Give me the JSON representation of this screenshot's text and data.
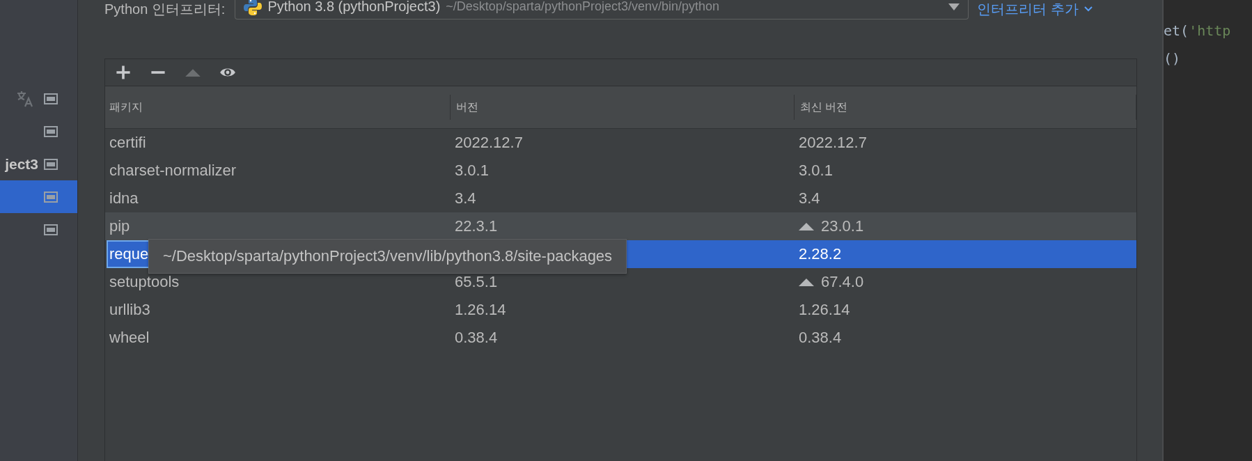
{
  "sidebar": {
    "items": [
      {
        "kind": "translate",
        "selected": false
      },
      {
        "kind": "plain",
        "selected": false
      },
      {
        "kind": "plain",
        "label": "ject3",
        "selected": false
      },
      {
        "kind": "plain",
        "selected": true
      },
      {
        "kind": "plain",
        "selected": false
      }
    ]
  },
  "interpreter": {
    "label": "Python 인터프리터:",
    "name": "Python 3.8 (pythonProject3)",
    "path": "~/Desktop/sparta/pythonProject3/venv/bin/python",
    "add_link": "인터프리터 추가"
  },
  "toolbar": [
    {
      "kind": "add",
      "disabled": false
    },
    {
      "kind": "remove",
      "disabled": false
    },
    {
      "kind": "upgrade",
      "disabled": true
    },
    {
      "kind": "eye",
      "disabled": false
    }
  ],
  "table": {
    "columns": [
      "패키지",
      "버전",
      "최신 버전"
    ],
    "rows": [
      {
        "name": "certifi",
        "version": "2022.12.7",
        "latest": "2022.12.7",
        "upgrade": false,
        "selected": false,
        "hovered": false,
        "focused": false
      },
      {
        "name": "charset-normalizer",
        "version": "3.0.1",
        "latest": "3.0.1",
        "upgrade": false,
        "selected": false,
        "hovered": false,
        "focused": false
      },
      {
        "name": "idna",
        "version": "3.4",
        "latest": "3.4",
        "upgrade": false,
        "selected": false,
        "hovered": false,
        "focused": false
      },
      {
        "name": "pip",
        "version": "22.3.1",
        "latest": "23.0.1",
        "upgrade": true,
        "selected": false,
        "hovered": true,
        "focused": false
      },
      {
        "name": "reque",
        "latest": "2.28.2",
        "upgrade": false,
        "selected": true,
        "hovered": false,
        "focused": true
      },
      {
        "name": "setuptools",
        "version": "65.5.1",
        "latest": "67.4.0",
        "upgrade": true,
        "selected": false,
        "hovered": false,
        "focused": false
      },
      {
        "name": "urllib3",
        "version": "1.26.14",
        "latest": "1.26.14",
        "upgrade": false,
        "selected": false,
        "hovered": false,
        "focused": false
      },
      {
        "name": "wheel",
        "version": "0.38.4",
        "latest": "0.38.4",
        "upgrade": false,
        "selected": false,
        "hovered": false,
        "focused": false
      }
    ]
  },
  "tooltip": {
    "text": "~/Desktop/sparta/pythonProject3/venv/lib/python3.8/site-packages"
  },
  "editor": {
    "lines": [
      [
        {
          "text": "et(",
          "kind": "code"
        },
        {
          "text": "'http",
          "kind": "string"
        }
      ],
      [
        {
          "text": "()",
          "kind": "code"
        }
      ]
    ]
  }
}
